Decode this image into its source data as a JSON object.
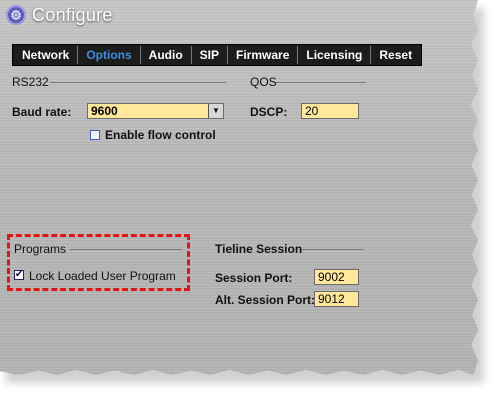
{
  "window": {
    "title": "Configure",
    "icon": "gear-icon"
  },
  "tabs": [
    {
      "label": "Network",
      "active": false
    },
    {
      "label": "Options",
      "active": true
    },
    {
      "label": "Audio",
      "active": false
    },
    {
      "label": "SIP",
      "active": false
    },
    {
      "label": "Firmware",
      "active": false
    },
    {
      "label": "Licensing",
      "active": false
    },
    {
      "label": "Reset",
      "active": false
    }
  ],
  "rs232": {
    "group_label": "RS232",
    "baud_label": "Baud rate:",
    "baud_value": "9600",
    "flow_control_label": "Enable flow control",
    "flow_control_checked": false
  },
  "qos": {
    "group_label": "QOS",
    "dscp_label": "DSCP:",
    "dscp_value": "20"
  },
  "programs": {
    "group_label": "Programs",
    "lock_label": "Lock Loaded User Program",
    "lock_checked": true
  },
  "tieline": {
    "group_label": "Tieline Session",
    "session_port_label": "Session Port:",
    "session_port_value": "9002",
    "alt_session_port_label": "Alt. Session Port:",
    "alt_session_port_value": "9012"
  },
  "colors": {
    "active_tab": "#3a8fe0",
    "input_bg": "#ffe89a",
    "highlight": "#e21515"
  }
}
